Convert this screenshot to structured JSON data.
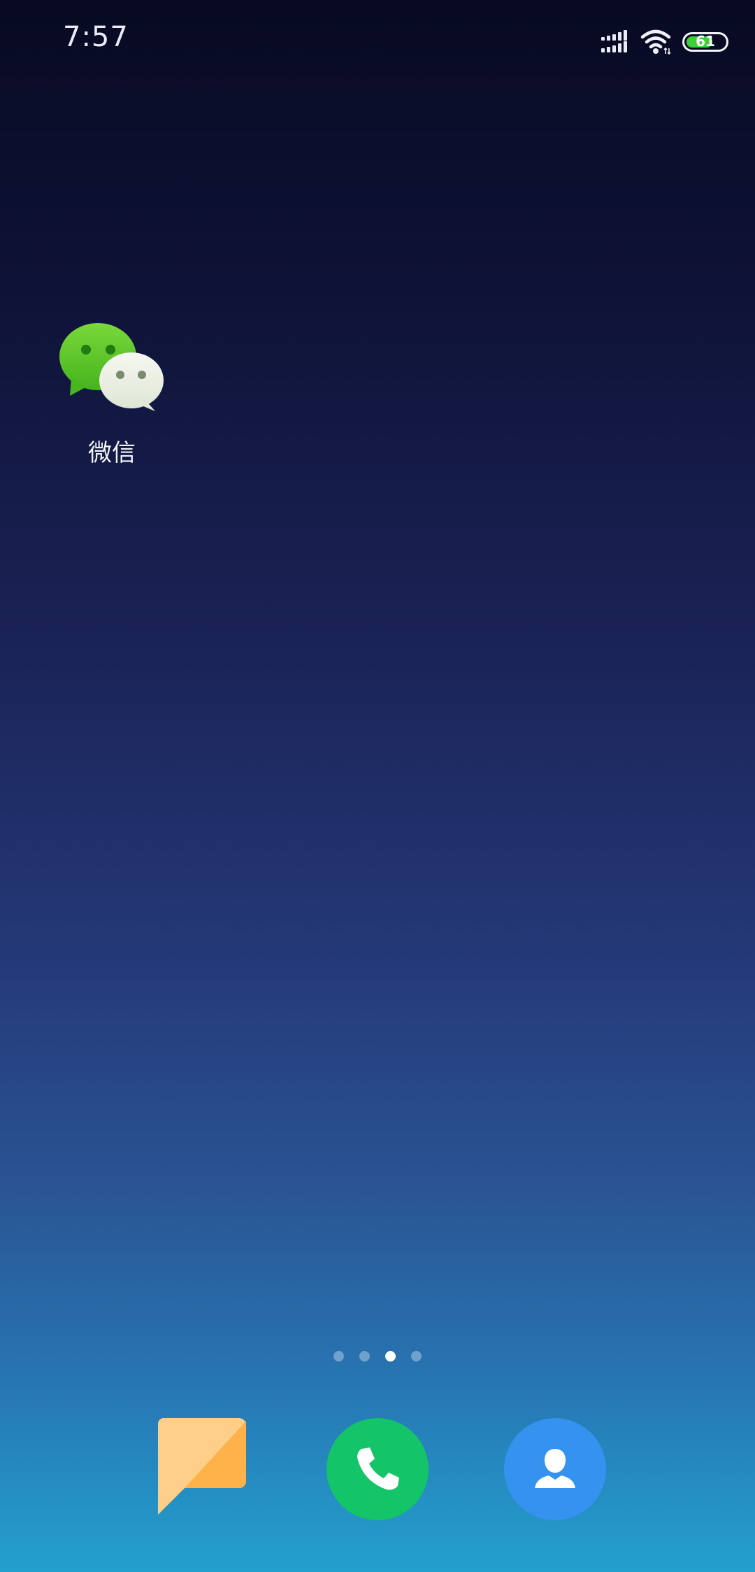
{
  "status_bar": {
    "time": "7:57",
    "battery_level": "61",
    "battery_percent": 0.61,
    "icons": [
      "signal-icon",
      "wifi-icon",
      "battery-icon"
    ]
  },
  "home": {
    "apps": [
      {
        "label": "微信",
        "icon": "wechat-icon"
      }
    ],
    "page_indicator": {
      "pages": 4,
      "active_index": 2
    }
  },
  "dock": [
    {
      "icon": "messages-icon",
      "color": "#ffb14a"
    },
    {
      "icon": "phone-icon",
      "color": "#13c468"
    },
    {
      "icon": "contacts-icon",
      "color": "#3592ef"
    }
  ],
  "colors": {
    "wechat_green": "#5bc82c",
    "phone_green": "#13c468",
    "contacts_blue": "#3592ef",
    "messages_orange": "#ffb14a",
    "battery_green": "#3ecf3a"
  }
}
